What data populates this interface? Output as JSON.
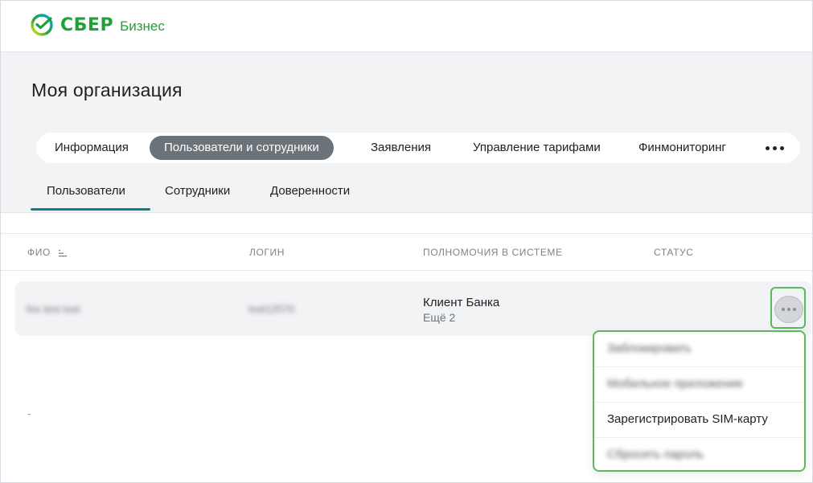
{
  "header": {
    "logo_main": "СБЕР",
    "logo_sub": "Бизнес",
    "logo_icon": "sber-logo-icon",
    "brand_color": "#21a038"
  },
  "page": {
    "title": "Моя организация"
  },
  "tabs": [
    {
      "label": "Информация",
      "active": false
    },
    {
      "label": "Пользователи и сотрудники",
      "active": true
    },
    {
      "label": "Заявления",
      "active": false
    },
    {
      "label": "Управление тарифами",
      "active": false
    },
    {
      "label": "Финмониторинг",
      "active": false
    }
  ],
  "tabs_more_icon": "more-horizontal-icon",
  "subtabs": [
    {
      "label": "Пользователи",
      "active": true
    },
    {
      "label": "Сотрудники",
      "active": false
    },
    {
      "label": "Доверенности",
      "active": false
    }
  ],
  "accent_color": "#107f8c",
  "table": {
    "columns": [
      "ФИО",
      "ЛОГИН",
      "ПОЛНОМОЧИЯ В СИСТЕМЕ",
      "СТАТУС"
    ],
    "rows": [
      {
        "fio": "fos test tost",
        "login": "tost12570",
        "role": "Клиент Банка",
        "role_more": "Ещё 2",
        "status": ""
      }
    ]
  },
  "row_menu": {
    "items": [
      {
        "label": "Заблокировать",
        "blurred": true
      },
      {
        "label": "Мобильное приложение",
        "blurred": true
      },
      {
        "label": "Зарегистрировать SIM-карту",
        "blurred": false
      },
      {
        "label": "Сбросить пароль",
        "blurred": true
      }
    ],
    "highlight_color": "#5cb85c"
  }
}
